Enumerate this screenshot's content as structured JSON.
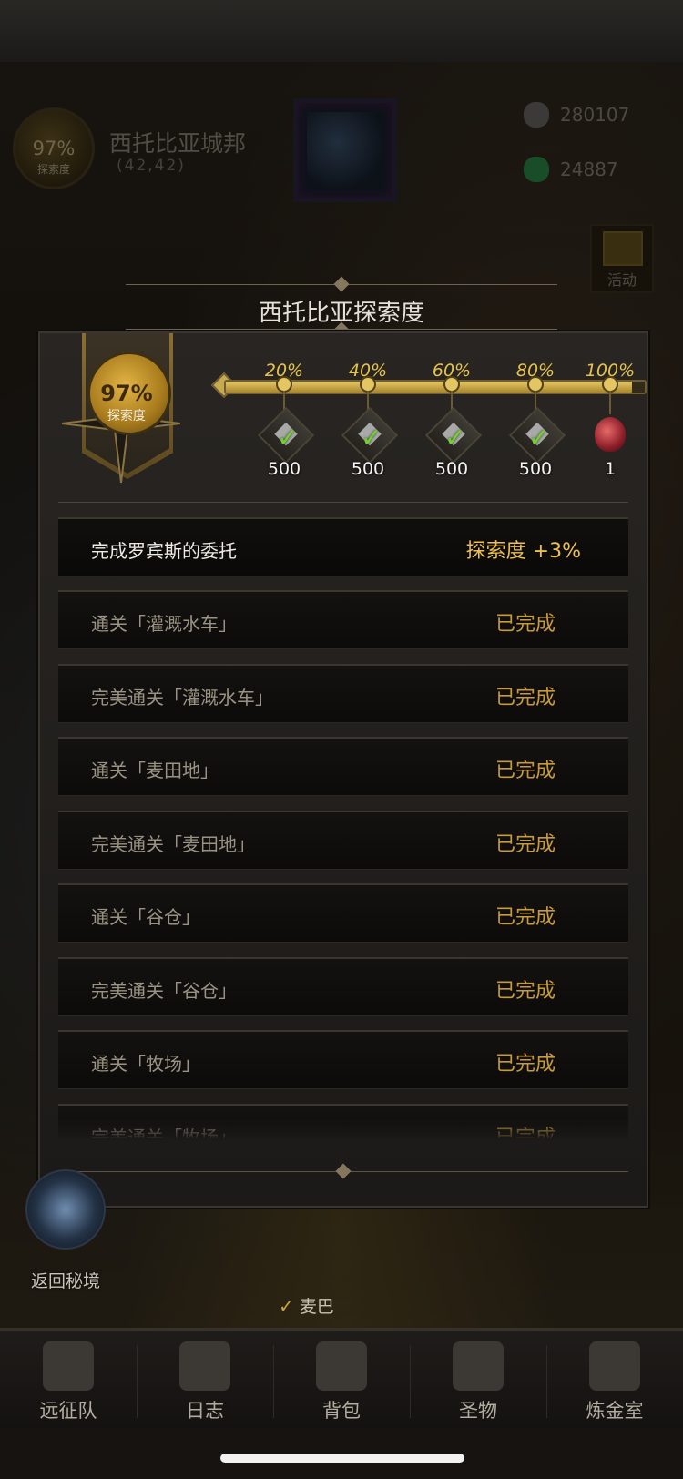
{
  "hud": {
    "medal_pct": "97%",
    "medal_label": "探索度",
    "city_name": "西托比亚城邦",
    "coords": "(42,42)",
    "resources": [
      {
        "icon": "stone-icon",
        "value": "280107",
        "color": "#6d6a66"
      },
      {
        "icon": "emerald-icon",
        "value": "24887",
        "color": "#2e8a4a"
      }
    ],
    "activity_label": "活动"
  },
  "modal": {
    "title": "西托比亚探索度",
    "badge_pct": "97%",
    "badge_label": "探索度",
    "progress": 0.97,
    "milestones": [
      {
        "label": "20%",
        "reward_count": "500",
        "claimed": true
      },
      {
        "label": "40%",
        "reward_count": "500",
        "claimed": true
      },
      {
        "label": "60%",
        "reward_count": "500",
        "claimed": true
      },
      {
        "label": "80%",
        "reward_count": "500",
        "claimed": true
      },
      {
        "label": "100%",
        "reward_count": "1",
        "claimed": false
      }
    ],
    "header_task": {
      "label": "完成罗宾斯的委托",
      "status": "探索度 +3%"
    },
    "tasks": [
      {
        "label": "通关「灌溉水车」",
        "status": "已完成"
      },
      {
        "label": "完美通关「灌溉水车」",
        "status": "已完成"
      },
      {
        "label": "通关「麦田地」",
        "status": "已完成"
      },
      {
        "label": "完美通关「麦田地」",
        "status": "已完成"
      },
      {
        "label": "通关「谷仓」",
        "status": "已完成"
      },
      {
        "label": "完美通关「谷仓」",
        "status": "已完成"
      },
      {
        "label": "通关「牧场」",
        "status": "已完成"
      },
      {
        "label": "完美通关「牧场」",
        "status": "已完成"
      }
    ],
    "colors": {
      "accent": "#e6c34a",
      "status": "#c79a3c"
    }
  },
  "map": {
    "portal_label": "返回秘境",
    "location_label": "麦巴"
  },
  "nav": [
    {
      "label": "远征队",
      "icon": "viking-helmet-icon"
    },
    {
      "label": "日志",
      "icon": "scroll-icon"
    },
    {
      "label": "背包",
      "icon": "backpack-icon"
    },
    {
      "label": "圣物",
      "icon": "chalice-icon"
    },
    {
      "label": "炼金室",
      "icon": "alchemy-icon"
    }
  ]
}
